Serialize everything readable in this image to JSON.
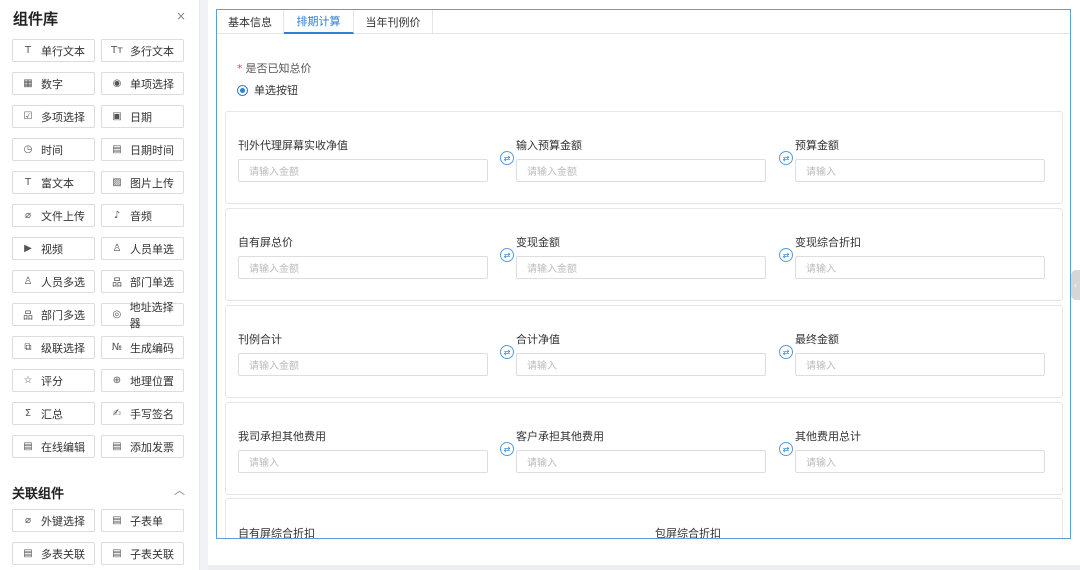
{
  "sidebar": {
    "title": "组件库",
    "close": "×",
    "components": [
      {
        "label": "单行文本",
        "icon": "T"
      },
      {
        "label": "多行文本",
        "icon": "Tт"
      },
      {
        "label": "数字",
        "icon": "▦"
      },
      {
        "label": "单项选择",
        "icon": "◉"
      },
      {
        "label": "多项选择",
        "icon": "☑"
      },
      {
        "label": "日期",
        "icon": "▣"
      },
      {
        "label": "时间",
        "icon": "◷"
      },
      {
        "label": "日期时间",
        "icon": "▤"
      },
      {
        "label": "富文本",
        "icon": "T"
      },
      {
        "label": "图片上传",
        "icon": "▨"
      },
      {
        "label": "文件上传",
        "icon": "⌀"
      },
      {
        "label": "音频",
        "icon": "♪"
      },
      {
        "label": "视频",
        "icon": "▶"
      },
      {
        "label": "人员单选",
        "icon": "♙"
      },
      {
        "label": "人员多选",
        "icon": "♙"
      },
      {
        "label": "部门单选",
        "icon": "品"
      },
      {
        "label": "部门多选",
        "icon": "品"
      },
      {
        "label": "地址选择器",
        "icon": "◎"
      },
      {
        "label": "级联选择",
        "icon": "⧉"
      },
      {
        "label": "生成编码",
        "icon": "№"
      },
      {
        "label": "评分",
        "icon": "☆"
      },
      {
        "label": "地理位置",
        "icon": "⊕"
      },
      {
        "label": "汇总",
        "icon": "Σ"
      },
      {
        "label": "手写签名",
        "icon": "✍"
      },
      {
        "label": "在线编辑",
        "icon": "▤"
      },
      {
        "label": "添加发票",
        "icon": "▤"
      }
    ],
    "group_title": "关联组件",
    "group_toggle": "︿",
    "related": [
      {
        "label": "外键选择",
        "icon": "⌀"
      },
      {
        "label": "子表单",
        "icon": "▤"
      },
      {
        "label": "多表关联",
        "icon": "▤"
      },
      {
        "label": "子表关联",
        "icon": "▤"
      }
    ]
  },
  "tabs": [
    {
      "label": "基本信息"
    },
    {
      "label": "排期计算"
    },
    {
      "label": "当年刊例价"
    }
  ],
  "form": {
    "required_label": "是否已知总价",
    "required_star": "*",
    "radio_label": "单选按钮",
    "swap_icon": "⇄",
    "rows": [
      {
        "fields": [
          {
            "label": "刊外代理屏幕实收净值",
            "placeholder": "请输入金额"
          },
          {
            "label": "输入预算金额",
            "placeholder": "请输入金额"
          },
          {
            "label": "预算金额",
            "placeholder": "请输入"
          }
        ]
      },
      {
        "fields": [
          {
            "label": "自有屏总价",
            "placeholder": "请输入金额"
          },
          {
            "label": "变现金额",
            "placeholder": "请输入金额"
          },
          {
            "label": "变现综合折扣",
            "placeholder": "请输入"
          }
        ]
      },
      {
        "fields": [
          {
            "label": "刊例合计",
            "placeholder": "请输入金额"
          },
          {
            "label": "合计净值",
            "placeholder": "请输入"
          },
          {
            "label": "最终金额",
            "placeholder": "请输入"
          }
        ]
      },
      {
        "fields": [
          {
            "label": "我司承担其他费用",
            "placeholder": "请输入"
          },
          {
            "label": "客户承担其他费用",
            "placeholder": "请输入"
          },
          {
            "label": "其他费用总计",
            "placeholder": "请输入"
          }
        ]
      }
    ],
    "last_row": [
      {
        "label": "自有屏综合折扣"
      },
      {
        "label": "包屏综合折扣"
      }
    ]
  },
  "colors": {
    "accent": "#2f7fd3",
    "required": "#e34d4d"
  }
}
